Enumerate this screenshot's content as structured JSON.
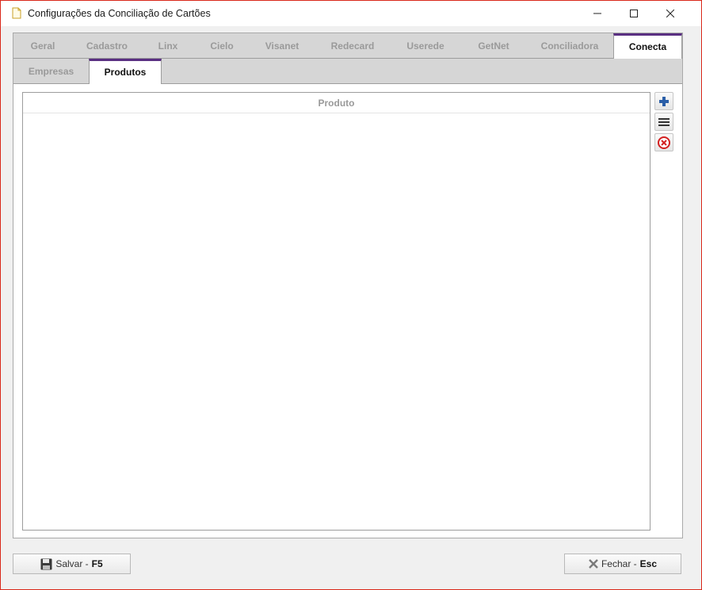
{
  "window": {
    "title": "Configurações da Conciliação de Cartões",
    "controls": {
      "minimize": "minimize-icon",
      "maximize": "maximize-icon",
      "close": "close-icon"
    }
  },
  "tabs_primary": [
    {
      "label": "Geral",
      "active": false
    },
    {
      "label": "Cadastro",
      "active": false
    },
    {
      "label": "Linx",
      "active": false
    },
    {
      "label": "Cielo",
      "active": false
    },
    {
      "label": "Visanet",
      "active": false
    },
    {
      "label": "Redecard",
      "active": false
    },
    {
      "label": "Userede",
      "active": false
    },
    {
      "label": "GetNet",
      "active": false
    },
    {
      "label": "Conciliadora",
      "active": false
    },
    {
      "label": "Conecta",
      "active": true
    }
  ],
  "tabs_secondary": [
    {
      "label": "Empresas",
      "active": false
    },
    {
      "label": "Produtos",
      "active": true
    }
  ],
  "grid": {
    "columns": [
      "Produto"
    ],
    "rows": []
  },
  "side_actions": [
    {
      "name": "add-button",
      "icon": "plus-icon"
    },
    {
      "name": "list-button",
      "icon": "list-icon"
    },
    {
      "name": "remove-button",
      "icon": "remove-circle-icon"
    }
  ],
  "footer": {
    "save": {
      "label": "Salvar - ",
      "hotkey": "F5",
      "icon": "floppy-disk-icon"
    },
    "close": {
      "label": "Fechar - ",
      "hotkey": "Esc",
      "icon": "x-icon"
    }
  },
  "colors": {
    "active_tab_accent": "#5a2f82",
    "window_border": "#d9281b",
    "add_icon": "#2b5fa8",
    "remove_icon": "#d32020"
  }
}
